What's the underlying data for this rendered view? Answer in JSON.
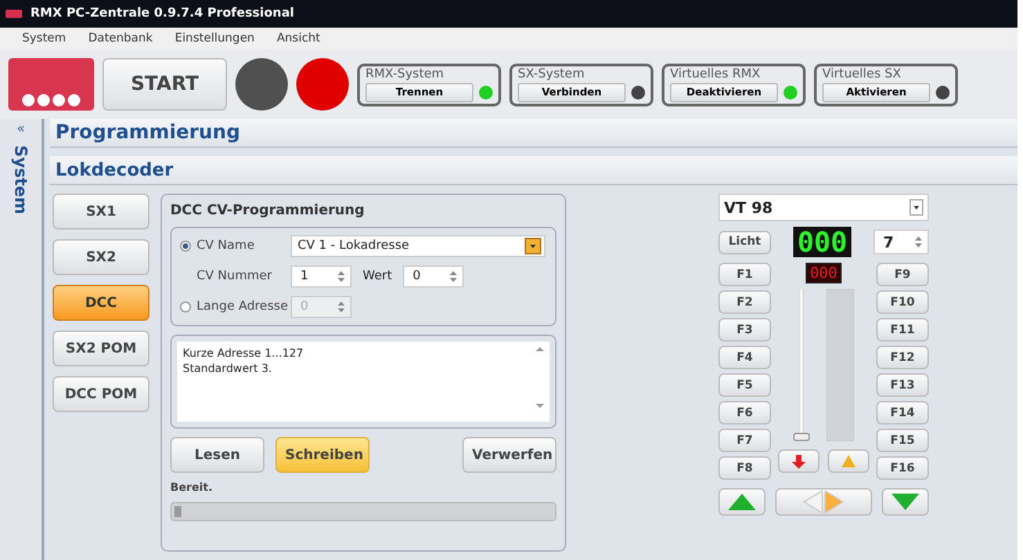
{
  "window": {
    "title": "RMX PC-Zentrale 0.9.7.4 Professional"
  },
  "menu": [
    "System",
    "Datenbank",
    "Einstellungen",
    "Ansicht"
  ],
  "toolbar": {
    "start": "START",
    "lamps": [
      {
        "color": "#505050"
      },
      {
        "color": "#e00000"
      }
    ],
    "systems": [
      {
        "title": "RMX-System",
        "button": "Trennen",
        "on": true
      },
      {
        "title": "SX-System",
        "button": "Verbinden",
        "on": false
      },
      {
        "title": "Virtuelles RMX",
        "button": "Deaktivieren",
        "on": true
      },
      {
        "title": "Virtuelles SX",
        "button": "Aktivieren",
        "on": false
      }
    ]
  },
  "sidebar": {
    "collapse": "«",
    "label": "System"
  },
  "header": "Programmierung",
  "subheader": "Lokdecoder",
  "modes": [
    {
      "label": "SX1",
      "selected": false
    },
    {
      "label": "SX2",
      "selected": false
    },
    {
      "label": "DCC",
      "selected": true
    },
    {
      "label": "SX2 POM",
      "selected": false
    },
    {
      "label": "DCC POM",
      "selected": false
    }
  ],
  "cv": {
    "title": "DCC CV-Programmierung",
    "cv_name": {
      "label": "CV Name",
      "selected": true,
      "value": "CV 1 - Lokadresse"
    },
    "cv_number": {
      "label": "CV Nummer",
      "value": "1"
    },
    "value": {
      "label": "Wert",
      "value": "0"
    },
    "long_address": {
      "label": "Lange Adresse",
      "selected": false,
      "value": "0",
      "disabled": true
    },
    "description": [
      "Kurze Adresse 1...127",
      "Standardwert 3."
    ],
    "buttons": [
      {
        "label": "Lesen",
        "selected": false
      },
      {
        "label": "Schreiben",
        "selected": true
      },
      {
        "label": "Verwerfen",
        "selected": false
      }
    ],
    "status": "Bereit.",
    "progress": {
      "level": 0.02
    }
  },
  "loco": {
    "name": "VT 98",
    "light": "Licht",
    "speed": "000",
    "step": "000",
    "steps_value": "7",
    "functions_left": [
      "F1",
      "F2",
      "F3",
      "F4",
      "F5",
      "F6",
      "F7",
      "F8"
    ],
    "functions_right": [
      "F9",
      "F10",
      "F11",
      "F12",
      "F13",
      "F14",
      "F15",
      "F16"
    ],
    "throttle": {
      "level": 0
    },
    "direction_forward": true
  }
}
